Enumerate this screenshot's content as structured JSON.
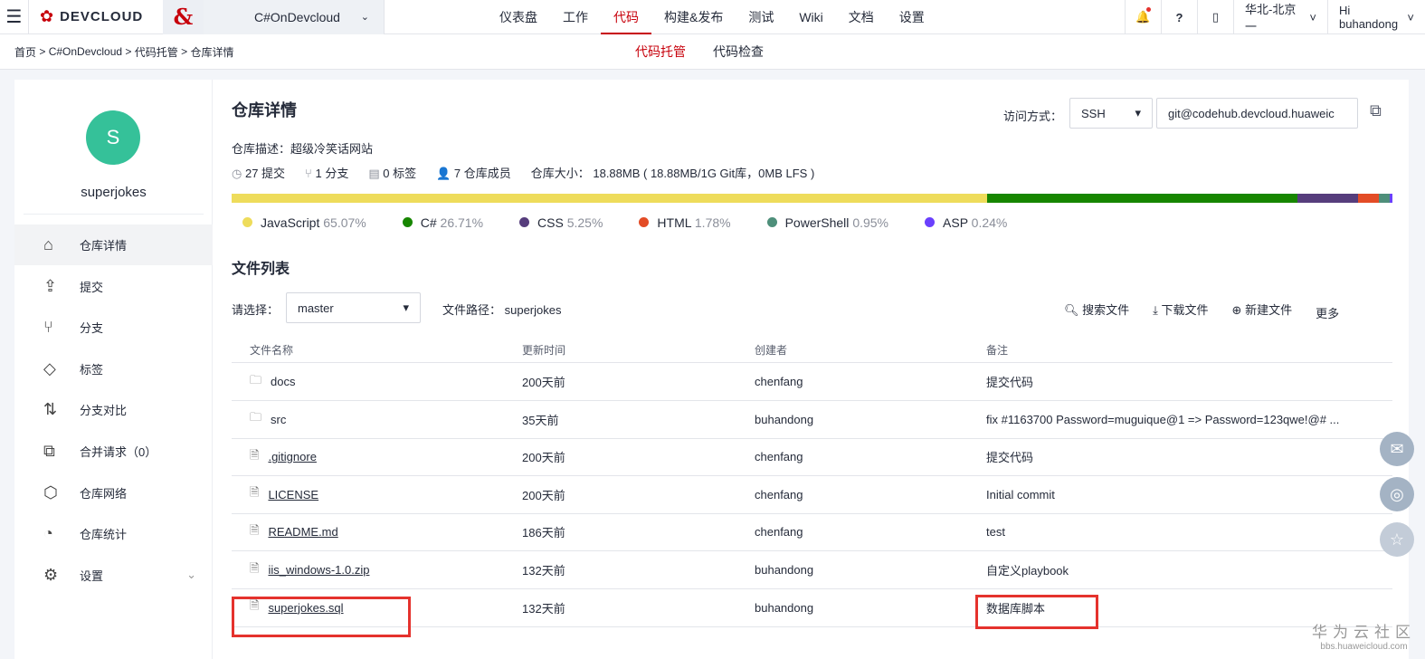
{
  "topbar": {
    "project": "C#OnDevcloud",
    "logo": "DEVCLOUD",
    "nav": [
      "仪表盘",
      "工作",
      "代码",
      "构建&发布",
      "测试",
      "Wiki",
      "文档",
      "设置"
    ],
    "active_nav": 2,
    "region": "华北-北京一",
    "user": "Hi buhandong"
  },
  "breadcrumb": [
    "首页",
    "C#OnDevcloud",
    "代码托管",
    "仓库详情"
  ],
  "subtabs": [
    "代码托管",
    "代码检查"
  ],
  "sidebar": {
    "avatar_letter": "S",
    "repo_name": "superjokes",
    "items": [
      {
        "label": "仓库详情",
        "icon": "home-icon"
      },
      {
        "label": "提交",
        "icon": "commit-icon"
      },
      {
        "label": "分支",
        "icon": "branch-icon"
      },
      {
        "label": "标签",
        "icon": "tag-icon"
      },
      {
        "label": "分支对比",
        "icon": "compare-icon"
      },
      {
        "label": "合并请求（0）",
        "icon": "merge-icon"
      },
      {
        "label": "仓库网络",
        "icon": "network-icon"
      },
      {
        "label": "仓库统计",
        "icon": "stats-icon"
      },
      {
        "label": "设置",
        "icon": "gear-icon"
      }
    ]
  },
  "repo": {
    "title": "仓库详情",
    "description": "仓库描述：超级冷笑话网站",
    "commits": "27 提交",
    "branches": "1 分支",
    "tags": "0 标签",
    "members": "7 仓库成员",
    "size": "仓库大小： 18.88MB ( 18.88MB/1G Git库，0MB LFS )",
    "access_label": "访问方式：",
    "access_method": "SSH",
    "clone_url": "git@codehub.devcloud.huaweic"
  },
  "languages": [
    {
      "name": "JavaScript",
      "pct": "65.07%",
      "value": 65.07,
      "color": "#eedc5b"
    },
    {
      "name": "C#",
      "pct": "26.71%",
      "value": 26.71,
      "color": "#178600"
    },
    {
      "name": "CSS",
      "pct": "5.25%",
      "value": 5.25,
      "color": "#563d7c"
    },
    {
      "name": "HTML",
      "pct": "1.78%",
      "value": 1.78,
      "color": "#e34c26"
    },
    {
      "name": "PowerShell",
      "pct": "0.95%",
      "value": 0.95,
      "color": "#4e8f7a"
    },
    {
      "name": "ASP",
      "pct": "0.24%",
      "value": 0.24,
      "color": "#6a40fd"
    }
  ],
  "files": {
    "title": "文件列表",
    "branch_label": "请选择：",
    "branch": "master",
    "path": "文件路径： superjokes",
    "actions": [
      "搜索文件",
      "下载文件",
      "新建文件",
      "更多"
    ],
    "headers": [
      "文件名称",
      "更新时间",
      "创建者",
      "备注"
    ],
    "rows": [
      {
        "name": "docs",
        "type": "folder",
        "time": "200天前",
        "creator": "chenfang",
        "note": "提交代码"
      },
      {
        "name": "src",
        "type": "folder",
        "time": "35天前",
        "creator": "buhandong",
        "note": "fix #1163700 Password=muguique@1 => Password=123qwe!@# ..."
      },
      {
        "name": ".gitignore",
        "type": "file",
        "time": "200天前",
        "creator": "chenfang",
        "note": "提交代码"
      },
      {
        "name": "LICENSE",
        "type": "file",
        "time": "200天前",
        "creator": "chenfang",
        "note": "Initial commit"
      },
      {
        "name": "README.md",
        "type": "file",
        "time": "186天前",
        "creator": "chenfang",
        "note": "test"
      },
      {
        "name": "iis_windows-1.0.zip",
        "type": "file",
        "time": "132天前",
        "creator": "buhandong",
        "note": "自定义playbook"
      },
      {
        "name": "superjokes.sql",
        "type": "file",
        "time": "132天前",
        "creator": "buhandong",
        "note": "数据库脚本"
      }
    ]
  },
  "watermark": {
    "title": "华为云社区",
    "url": "bbs.huaweicloud.com"
  }
}
